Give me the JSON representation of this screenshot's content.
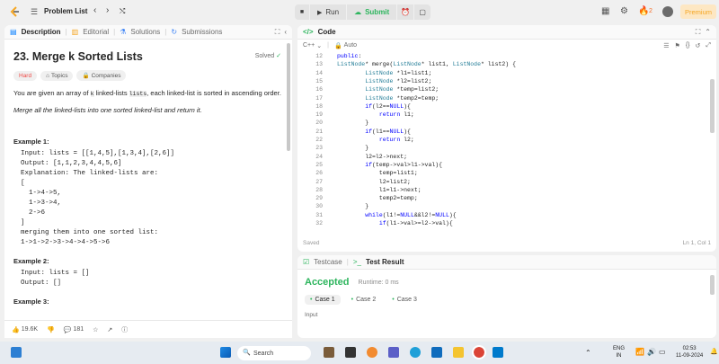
{
  "topnav": {
    "title": "Problem List",
    "run_label": "Run",
    "submit_label": "Submit",
    "streak_count": "2",
    "premium_label": "Premium"
  },
  "left": {
    "tabs": [
      "Description",
      "Editorial",
      "Solutions",
      "Submissions"
    ],
    "problem_title": "23. Merge k Sorted Lists",
    "solved_label": "Solved",
    "tags": [
      "Hard",
      "Topics",
      "Companies"
    ],
    "desc_p1_a": "You are given an array of ",
    "desc_p1_k": "k",
    "desc_p1_b": " linked-lists ",
    "desc_p1_lists": "lists",
    "desc_p1_c": ", each linked-list is sorted in ascending order.",
    "desc_p2": "Merge all the linked-lists into one sorted linked-list and return it.",
    "example1_head": "Example 1:",
    "example1_lines": [
      "Input: lists = [[1,4,5],[1,3,4],[2,6]]",
      "Output: [1,1,2,3,4,4,5,6]",
      "Explanation: The linked-lists are:",
      "[",
      "  1->4->5,",
      "  1->3->4,",
      "  2->6",
      "]",
      "merging them into one sorted list:",
      "1->1->2->3->4->4->5->6"
    ],
    "example2_head": "Example 2:",
    "example2_lines": [
      "Input: lists = []",
      "Output: []"
    ],
    "example3_head": "Example 3:",
    "footer": {
      "likes": "19.6K",
      "comments": "181"
    }
  },
  "code": {
    "tab": "Code",
    "language": "C++",
    "mode": "Auto",
    "status_left": "Saved",
    "status_right": "Ln 1, Col 1",
    "lines": [
      {
        "n": "12",
        "t": "public:"
      },
      {
        "n": "13",
        "t": "ListNode* merge(ListNode* list1, ListNode* list2) {"
      },
      {
        "n": "14",
        "t": "        ListNode *l1=list1;"
      },
      {
        "n": "15",
        "t": "        ListNode *l2=list2;"
      },
      {
        "n": "16",
        "t": "        ListNode *temp=list2;"
      },
      {
        "n": "17",
        "t": "        ListNode *temp2=temp;"
      },
      {
        "n": "18",
        "t": "        if(l2==NULL){"
      },
      {
        "n": "19",
        "t": "            return l1;"
      },
      {
        "n": "20",
        "t": "        }"
      },
      {
        "n": "21",
        "t": "        if(l1==NULL){"
      },
      {
        "n": "22",
        "t": "            return l2;"
      },
      {
        "n": "23",
        "t": "        }"
      },
      {
        "n": "24",
        "t": "        l2=l2->next;"
      },
      {
        "n": "25",
        "t": "        if(temp->val>l1->val){"
      },
      {
        "n": "26",
        "t": "            temp=list1;"
      },
      {
        "n": "27",
        "t": "            l2=list2;"
      },
      {
        "n": "28",
        "t": "            l1=l1->next;"
      },
      {
        "n": "29",
        "t": "            temp2=temp;"
      },
      {
        "n": "30",
        "t": "        }"
      },
      {
        "n": "31",
        "t": "        while(l1!=NULL&&l2!=NULL){"
      },
      {
        "n": "32",
        "t": "            if(l1->val>=l2->val){"
      }
    ]
  },
  "result": {
    "tabs": [
      "Testcase",
      "Test Result"
    ],
    "accepted": "Accepted",
    "runtime": "Runtime: 0 ms",
    "cases": [
      "Case 1",
      "Case 2",
      "Case 3"
    ],
    "input_label": "Input"
  },
  "taskbar": {
    "search_placeholder": "Search",
    "lang": "ENG",
    "region": "IN",
    "time": "02:53",
    "date": "11-09-2024"
  }
}
